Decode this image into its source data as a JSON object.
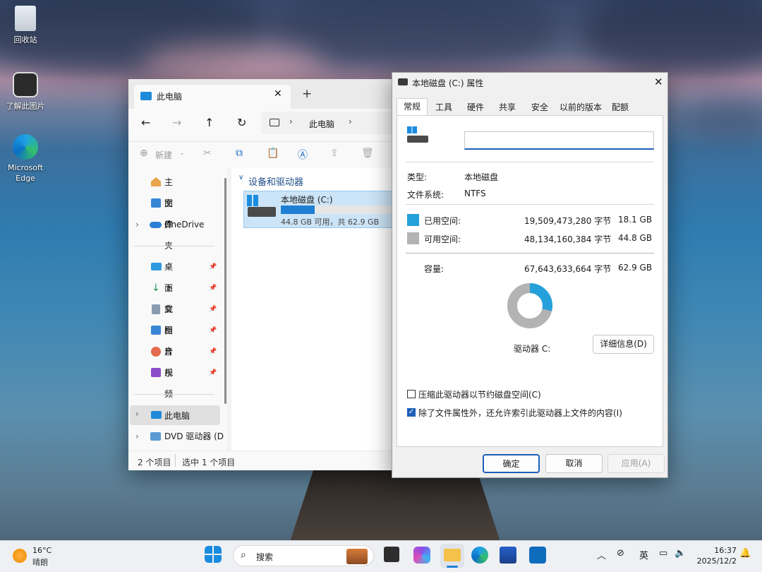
{
  "desktop": {
    "icons": [
      {
        "label": "回收站"
      },
      {
        "label": "了解此图片"
      },
      {
        "label": "Microsoft Edge"
      }
    ]
  },
  "explorer": {
    "tab_title": "此电脑",
    "breadcrumb": "此电脑",
    "new_label": "新建",
    "nav": {
      "home": "主文件夹",
      "gallery": "图库",
      "onedrive": "OneDrive",
      "quick": [
        "桌面",
        "下载",
        "文档",
        "图片",
        "音乐",
        "视频"
      ],
      "this_pc": "此电脑",
      "dvd": "DVD 驱动器 (D"
    },
    "section_title": "设备和驱动器",
    "drive": {
      "name": "本地磁盘 (C:)",
      "free_text": "44.8 GB 可用，共 62.9 GB",
      "used_fraction": 0.288
    },
    "status": {
      "items": "2 个项目",
      "selected": "选中 1 个项目"
    }
  },
  "props": {
    "title": "本地磁盘 (C:) 属性",
    "tabs": [
      "常规",
      "工具",
      "硬件",
      "共享",
      "安全",
      "以前的版本",
      "配额"
    ],
    "name_value": "",
    "type_label": "类型:",
    "type_value": "本地磁盘",
    "fs_label": "文件系统:",
    "fs_value": "NTFS",
    "used_label": "已用空间:",
    "used_bytes": "19,509,473,280 字节",
    "used_size": "18.1 GB",
    "free_label": "可用空间:",
    "free_bytes": "48,134,160,384 字节",
    "free_size": "44.8 GB",
    "cap_label": "容量:",
    "cap_bytes": "67,643,633,664 字节",
    "cap_size": "62.9 GB",
    "used_fraction": 0.288,
    "drive_label": "驱动器 C:",
    "details_button": "详细信息(D)",
    "compress_label": "压缩此驱动器以节约磁盘空间(C)",
    "index_label": "除了文件属性外，还允许索引此驱动器上文件的内容(I)",
    "ok": "确定",
    "cancel": "取消",
    "apply": "应用(A)",
    "colors": {
      "used": "#26a0da",
      "free": "#b3b3b3"
    }
  },
  "taskbar": {
    "weather_temp": "16°C",
    "weather_desc": "晴朗",
    "search": "搜索",
    "ime": "英",
    "time": "16:37",
    "date": "2025/12/2"
  }
}
